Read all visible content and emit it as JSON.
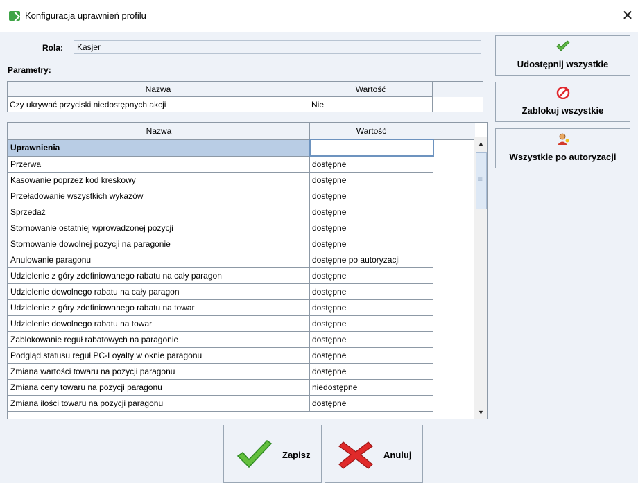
{
  "window": {
    "title": "Konfiguracja uprawnień profilu"
  },
  "rola": {
    "label": "Rola:",
    "value": "Kasjer"
  },
  "parametry_label": "Parametry:",
  "grid1": {
    "headers": [
      "Nazwa",
      "Wartość"
    ],
    "rows": [
      {
        "name": "Czy ukrywać przyciski niedostępnych akcji",
        "value": "Nie"
      }
    ]
  },
  "grid2": {
    "headers": [
      "Nazwa",
      "Wartość"
    ],
    "section": "Uprawnienia",
    "rows": [
      {
        "name": "Przerwa",
        "value": "dostępne"
      },
      {
        "name": "Kasowanie poprzez kod kreskowy",
        "value": "dostępne"
      },
      {
        "name": "Przeładowanie wszystkich wykazów",
        "value": "dostępne"
      },
      {
        "name": "Sprzedaż",
        "value": "dostępne"
      },
      {
        "name": "Stornowanie ostatniej wprowadzonej pozycji",
        "value": "dostępne"
      },
      {
        "name": "Stornowanie dowolnej pozycji na paragonie",
        "value": "dostępne"
      },
      {
        "name": "Anulowanie paragonu",
        "value": "dostępne po autoryzacji"
      },
      {
        "name": "Udzielenie z góry zdefiniowanego rabatu na cały paragon",
        "value": "dostępne"
      },
      {
        "name": "Udzielenie dowolnego rabatu na cały paragon",
        "value": "dostępne"
      },
      {
        "name": "Udzielenie z góry zdefiniowanego rabatu na towar",
        "value": "dostępne"
      },
      {
        "name": "Udzielenie dowolnego rabatu na towar",
        "value": "dostępne"
      },
      {
        "name": "Zablokowanie reguł rabatowych na paragonie",
        "value": "dostępne"
      },
      {
        "name": "Podgląd statusu reguł PC-Loyalty w oknie paragonu",
        "value": "dostępne"
      },
      {
        "name": "Zmiana wartości towaru na pozycji paragonu",
        "value": "dostępne"
      },
      {
        "name": "Zmiana ceny towaru na pozycji paragonu",
        "value": "niedostępne"
      },
      {
        "name": "Zmiana ilości towaru na pozycji paragonu",
        "value": "dostępne"
      }
    ]
  },
  "side_buttons": {
    "enable_all": "Udostępnij wszystkie",
    "block_all": "Zablokuj wszystkie",
    "all_auth": "Wszystkie po autoryzacji"
  },
  "footer": {
    "save": "Zapisz",
    "cancel": "Anuluj"
  },
  "icons": {
    "app": "app-icon",
    "close": "close-icon",
    "check": "check-icon",
    "block": "block-icon",
    "person": "person-icon",
    "cross": "cross-icon"
  },
  "colors": {
    "accent_green": "#3fa447",
    "block_red": "#e0282e",
    "section_bg": "#b9cde5"
  }
}
